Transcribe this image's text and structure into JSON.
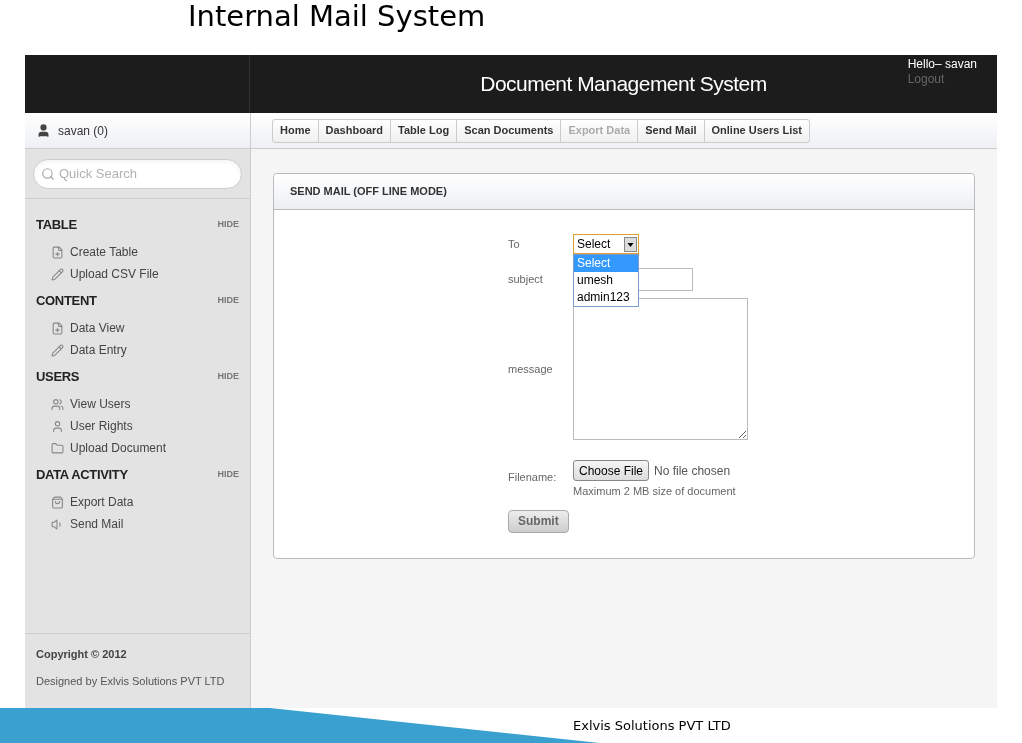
{
  "slide_title": "Internal Mail System",
  "header": {
    "title": "Document Management System",
    "greeting": "Hello– savan",
    "logout": "Logout"
  },
  "user_bar": {
    "name": "savan (0)"
  },
  "search": {
    "placeholder": "Quick Search"
  },
  "sidebar": [
    {
      "title": "TABLE",
      "toggle": "HIDE",
      "items": [
        "Create Table",
        "Upload CSV File"
      ]
    },
    {
      "title": "CONTENT",
      "toggle": "HIDE",
      "items": [
        "Data View",
        "Data Entry"
      ]
    },
    {
      "title": "USERS",
      "toggle": "HIDE",
      "items": [
        "View Users",
        "User Rights",
        "Upload Document"
      ]
    },
    {
      "title": "DATA ACTIVITY",
      "toggle": "HIDE",
      "items": [
        "Export Data",
        "Send Mail"
      ]
    }
  ],
  "footer": {
    "copyright": "Copyright © 2012",
    "designed_by": "Designed by Exlvis Solutions PVT LTD"
  },
  "breadcrumb": [
    {
      "label": "Home",
      "disabled": false
    },
    {
      "label": "Dashboard",
      "disabled": false
    },
    {
      "label": "Table Log",
      "disabled": false
    },
    {
      "label": "Scan Documents",
      "disabled": false
    },
    {
      "label": "Export Data",
      "disabled": true
    },
    {
      "label": "Send Mail",
      "disabled": false
    },
    {
      "label": "Online Users List",
      "disabled": false
    }
  ],
  "panel": {
    "title": "SEND MAIL (OFF LINE MODE)"
  },
  "form": {
    "to_label": "To",
    "to_value": "Select",
    "expanded": true,
    "options": [
      {
        "label": "Select",
        "selected": true
      },
      {
        "label": "umesh",
        "selected": false
      },
      {
        "label": "admin123",
        "selected": false
      }
    ],
    "subject_label": "subject",
    "message_label": "message",
    "file_label": "Filename:",
    "file_button": "Choose File",
    "file_status": "No file chosen",
    "file_hint": "Maximum 2 MB size of document",
    "submit": "Submit"
  },
  "slide_footer": "Exlvis Solutions PVT LTD"
}
